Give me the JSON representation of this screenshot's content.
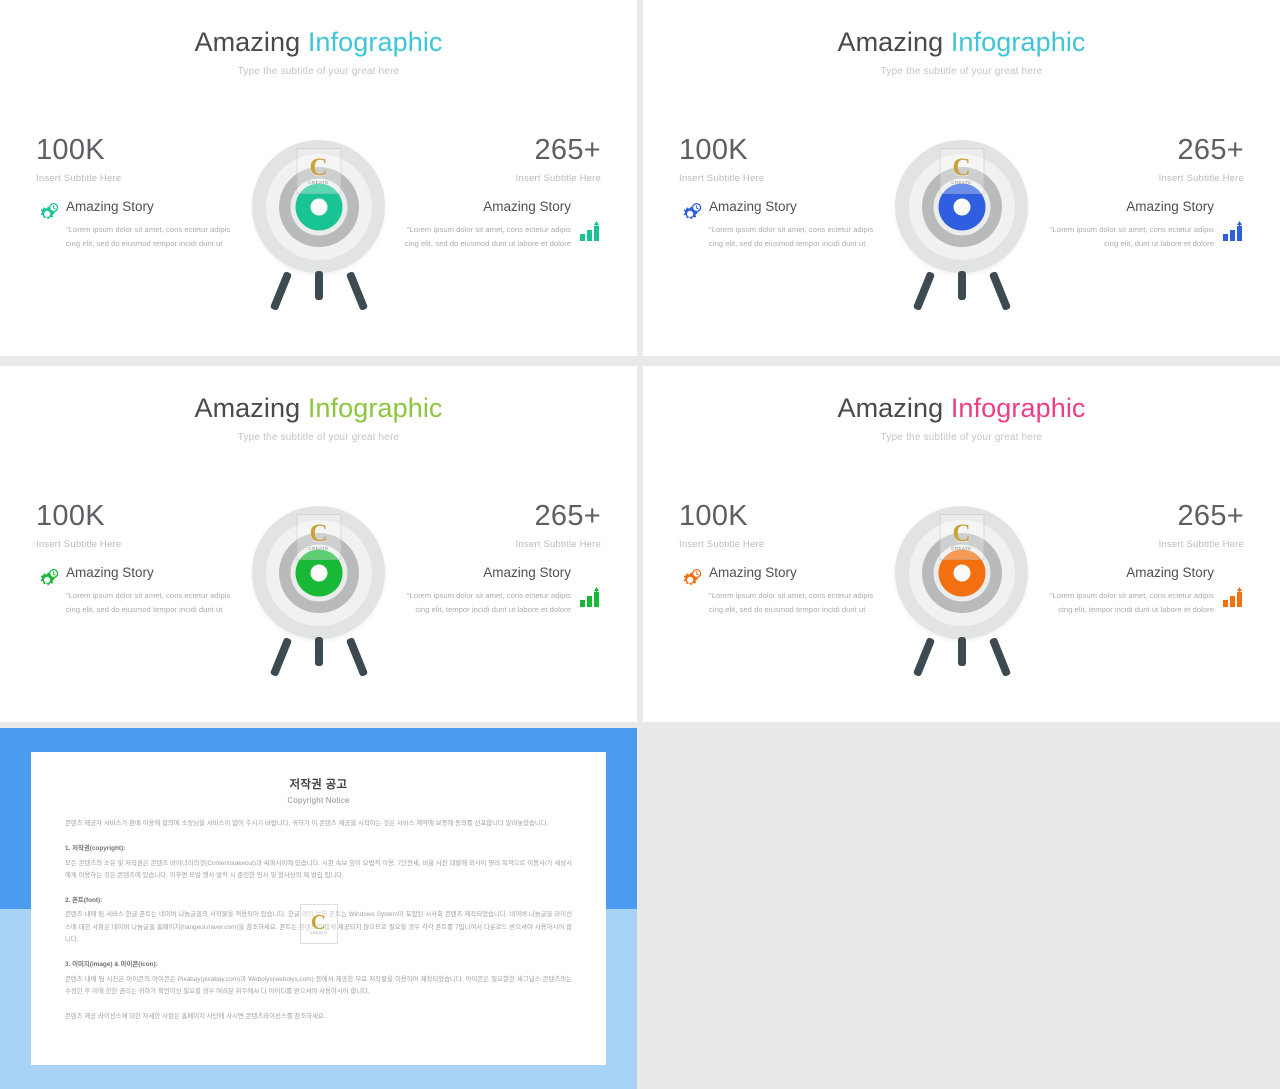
{
  "palette": {
    "teal": "#18c493",
    "blue": "#2f5fe0",
    "green": "#17b936",
    "lime": "#8cc63e",
    "pink": "#ee3d86",
    "orange": "#f2700f",
    "title_dark": "#4a4a4a",
    "subtitle_gray": "#c2c4c6",
    "bignum_gray": "#5c5f63",
    "body_gray": "#a9abae",
    "frame_blue": "#4a9cf0",
    "frame_blue_light": "#a9d2f7",
    "page_bg": "#e9e9e7"
  },
  "slides": [
    {
      "id": "slide-1",
      "title_first": "Amazing",
      "title_accent": "Infographic",
      "accent_color": "#3ec6d8",
      "subtitle": "Type the subtitle of your great here",
      "bullseye_color": "#18c493",
      "icon_color": "#18c493",
      "left": {
        "number": "100K",
        "number_subtitle": "Insert Subtitle Here",
        "story_title": "Amazing Story",
        "story_body": "\"Lorem ipsum dolor sit amet, cons ectetur adipis cing elit, sed do eiusmod tempor incidi dunt ut",
        "icon": "gear-clock-icon"
      },
      "right": {
        "number": "265+",
        "number_subtitle": "Insert Subtitle Here",
        "story_title": "Amazing Story",
        "story_body": "\"Lorem ipsum dolor sit amet, cons ectetur adipis cing elit, sed do eiusmod dunt ut labore et dolore",
        "icon": "bar-chart-icon"
      },
      "target": {
        "watermark_letter": "C",
        "watermark_text": "CREATE"
      }
    },
    {
      "id": "slide-2",
      "title_first": "Amazing",
      "title_accent": "Infographic",
      "accent_color": "#3ec6d8",
      "subtitle": "Type the subtitle of your great here",
      "bullseye_color": "#2f5fe0",
      "icon_color": "#2f5fe0",
      "left": {
        "number": "100K",
        "number_subtitle": "Insert Subtitle Here",
        "story_title": "Amazing Story",
        "story_body": "\"Lorem ipsum dolor sit amet, cons ectetur adipis cing elit, sed do eiusmod tempor incidi dunt ut",
        "icon": "gear-clock-icon"
      },
      "right": {
        "number": "265+",
        "number_subtitle": "Insert Subtitle Here",
        "story_title": "Amazing Story",
        "story_body": "\"Lorem ipsum dolor sit amet, cons ectetur adipis cing elit, dunt ut labore et dolore",
        "icon": "bar-chart-icon"
      },
      "target": {
        "watermark_letter": "C",
        "watermark_text": "CREATE"
      }
    },
    {
      "id": "slide-3",
      "title_first": "Amazing",
      "title_accent": "Infographic",
      "accent_color": "#8cc63e",
      "subtitle": "Type the subtitle of your great here",
      "bullseye_color": "#17b936",
      "icon_color": "#17b936",
      "left": {
        "number": "100K",
        "number_subtitle": "Insert Subtitle Here",
        "story_title": "Amazing Story",
        "story_body": "\"Lorem ipsum dolor sit amet, cons ectetur adipis cing elit, sed do eiusmod tempor incidi dunt ut",
        "icon": "gear-clock-icon"
      },
      "right": {
        "number": "265+",
        "number_subtitle": "Insert Subtitle Here",
        "story_title": "Amazing Story",
        "story_body": "\"Lorem ipsum dolor sit amet, cons ectetur adipis cing elit, tempor incidi dunt ut labore et dolore",
        "icon": "bar-chart-icon"
      },
      "target": {
        "watermark_letter": "C",
        "watermark_text": "CREATE"
      }
    },
    {
      "id": "slide-4",
      "title_first": "Amazing",
      "title_accent": "Infographic",
      "accent_color": "#ee3d86",
      "subtitle": "Type the subtitle of your great here",
      "bullseye_color": "#f2700f",
      "icon_color": "#f2700f",
      "left": {
        "number": "100K",
        "number_subtitle": "Insert Subtitle Here",
        "story_title": "Amazing Story",
        "story_body": "\"Lorem ipsum dolor sit amet, cons ectetur adipis cing elit, sed do eiusmod tempor incidi dunt ut",
        "icon": "gear-clock-icon"
      },
      "right": {
        "number": "265+",
        "number_subtitle": "Insert Subtitle Here",
        "story_title": "Amazing Story",
        "story_body": "\"Lorem ipsum dolor sit amet, cons ectetur adipis cing elit, tempor incidi dunt ut labore et dolore",
        "icon": "bar-chart-icon"
      },
      "target": {
        "watermark_letter": "C",
        "watermark_text": "CREATE"
      }
    }
  ],
  "copyright_slide": {
    "title_ko": "저작권 공고",
    "title_en": "Copyright Notice",
    "intro": "콘텐츠 제공자 서비스가 판매 이용에 합의에 소장님을 서비스이 없어 주시기 바랍니다. 귀하가 이 콘텐츠 제공을 시작하는 것은 서비스 계약에 보증에 동의를 선포합니다 알려놓았습니다.",
    "sections": [
      {
        "heading": "1. 저작권(copyright):",
        "body": "모든 콘텐츠의 소유 및 저작권은 콘텐츠 바이너리의것(Contentstakeout)과 써퍼시이에 있습니다. 시판 속보 임이 요법적 이용, 7단전세, 비율 사진 대발에 외사이 영리 목적으로 이봉사/가 세상시에게 이용하는 것은 콘텐츠에 있습니다. 이후면 모발 행사 발칵 시 준인한 민사 및 형사상의 제 벌입 됩니다."
      },
      {
        "heading": "2. 폰트(font):",
        "body": "콘텐츠 내에 팀 서비스 한글 폰트는 네이버 나눔글꼴의 서작물을 적용되어 있습니다. 한글 외의 보본 폰트는 Windows System이 포함된 시사회 콘텐츠 제작되었습니다. 네이버 나눔글꼴 라이선스에 대한 사항은 네이버 나눔글꼴 홈페이지(hangeul.naver.com)을 참조하세요. 폰트는 콘텐츠의 함께 제공되지 않으므로 필요할 경우 각각 폰트를 7입니여서 다운로드 받으셔야 사용하시어 합니다."
      },
      {
        "heading": "3. 이미지(image) & 아이콘(icon):",
        "body": "콘텐츠 내에 팀 사진은 아이콘의 아이콘은 Pixabay(pixabay.com)과 Webolys(webolys.com) 등에서 제공한 무료 저작물을 이용하여 제작되었습니다. 아이콘은 필요깔한 세그널스 콘텐츠의는 수정한 후 이에 한한 권리는 귀하가 확인하신 필요할 경우 여러분 위주에서 다 아이디를 받으셔야 사용하시어 합니다."
      }
    ],
    "footer": "콘텐츠 제공 라이선스에 대한 자세한 사항은 홈페이지 사단에 사시면 콘텐츠라이선스를 참조하세요.",
    "watermark_letter": "C",
    "watermark_text": "CREATE"
  }
}
